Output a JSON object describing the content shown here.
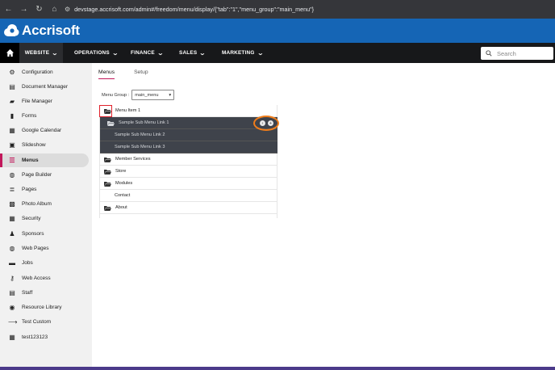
{
  "browser": {
    "url": "devstage.accrisoft.com/admin#/freedom/menu/display/{\"tab\":\"1\",\"menu_group\":\"main_menu\"}"
  },
  "brand": {
    "name": "Accrisoft"
  },
  "topnav": {
    "items": [
      {
        "label": "WEBSITE"
      },
      {
        "label": "OPERATIONS"
      },
      {
        "label": "FINANCE"
      },
      {
        "label": "SALES"
      },
      {
        "label": "MARKETING"
      }
    ],
    "search_placeholder": "Search"
  },
  "sidebar": {
    "items": [
      {
        "label": "Configuration",
        "icon": "gears-icon"
      },
      {
        "label": "Document Manager",
        "icon": "document-icon"
      },
      {
        "label": "File Manager",
        "icon": "folder-open-icon"
      },
      {
        "label": "Forms",
        "icon": "clipboard-icon"
      },
      {
        "label": "Google Calendar",
        "icon": "calendar-icon"
      },
      {
        "label": "Slideshow",
        "icon": "slideshow-icon"
      },
      {
        "label": "Menus",
        "icon": "list-icon"
      },
      {
        "label": "Page Builder",
        "icon": "globe-icon"
      },
      {
        "label": "Pages",
        "icon": "pages-icon"
      },
      {
        "label": "Photo Album",
        "icon": "photo-icon"
      },
      {
        "label": "Security",
        "icon": "grid-icon"
      },
      {
        "label": "Sponsors",
        "icon": "sponsor-icon"
      },
      {
        "label": "Web Pages",
        "icon": "globe-icon"
      },
      {
        "label": "Jobs",
        "icon": "briefcase-icon"
      },
      {
        "label": "Web Access",
        "icon": "key-icon"
      },
      {
        "label": "Staff",
        "icon": "id-card-icon"
      },
      {
        "label": "Resource Library",
        "icon": "circle-icon"
      },
      {
        "label": "Test Custom",
        "icon": "arrow-icon"
      },
      {
        "label": "test123123",
        "icon": "grid-icon"
      }
    ],
    "active": "Menus"
  },
  "tabs": [
    {
      "label": "Menus"
    },
    {
      "label": "Setup"
    }
  ],
  "menu_group": {
    "label": "Menu Group :",
    "value": "main_menu"
  },
  "tree": [
    {
      "label": "Menu Item 1",
      "folder": true,
      "indent": 0,
      "selected": false
    },
    {
      "label": "Sample Sub Menu Link 1",
      "folder": true,
      "indent": 1,
      "selected": true
    },
    {
      "label": "Sample Sub Menu Link 2",
      "folder": false,
      "indent": 1,
      "selected": true
    },
    {
      "label": "Sample Sub Menu Link 3",
      "folder": false,
      "indent": 1,
      "selected": true
    },
    {
      "label": "Member Services",
      "folder": true,
      "indent": 0,
      "selected": false
    },
    {
      "label": "Store",
      "folder": true,
      "indent": 0,
      "selected": false
    },
    {
      "label": "Modules",
      "folder": true,
      "indent": 0,
      "selected": false
    },
    {
      "label": "Contact",
      "folder": false,
      "indent": 0,
      "selected": false
    },
    {
      "label": "About",
      "folder": true,
      "indent": 0,
      "selected": false
    }
  ],
  "row_actions": {
    "edit_icon": "chevron-right-icon",
    "add_icon": "plus-icon"
  },
  "colors": {
    "brand_blue": "#1565b5",
    "accent": "#c2185b",
    "highlight_red": "#e0202a",
    "highlight_orange": "#f07d1a"
  }
}
